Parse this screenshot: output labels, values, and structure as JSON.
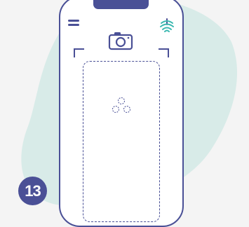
{
  "step": {
    "number": "13"
  },
  "colors": {
    "background": "#f4f4f4",
    "blob": "#d8ebe8",
    "accent": "#4a5096",
    "logo_teal": "#3ab8b0",
    "phone_screen": "#ffffff"
  },
  "icons": {
    "menu": "hamburger-menu-icon",
    "camera": "camera-icon",
    "logo": "fingerprint-logo-icon",
    "placeholder": "three-circles-icon"
  }
}
